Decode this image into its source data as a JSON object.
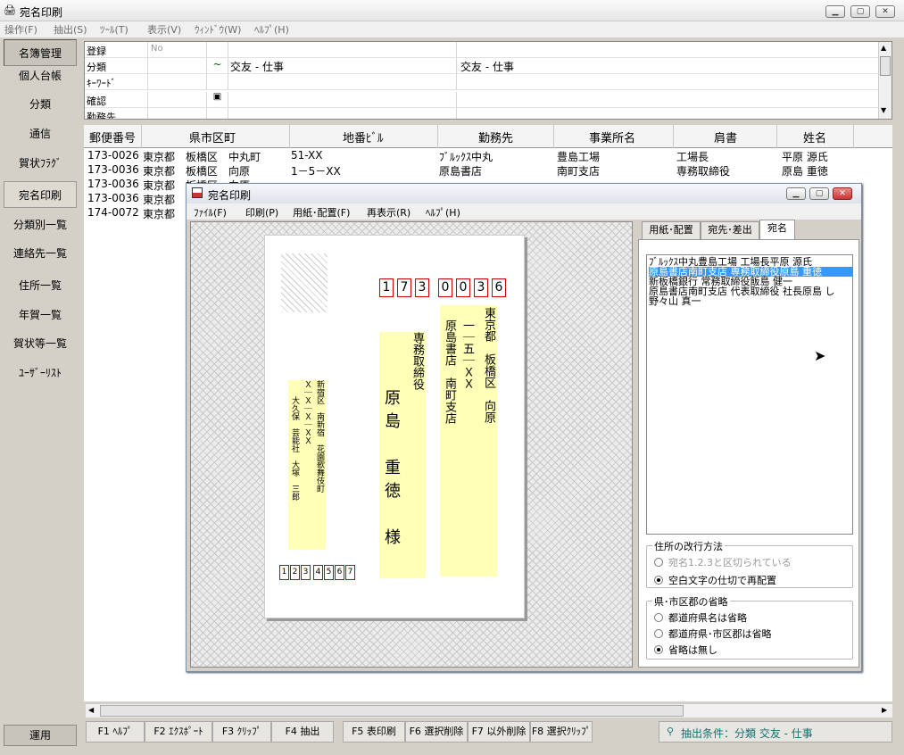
{
  "app": {
    "title": "宛名印刷",
    "menu": [
      "操作(F)",
      "抽出(S)",
      "ﾂｰﾙ(T)",
      "表示(V)",
      "ｳｨﾝﾄﾞｳ(W)",
      "ﾍﾙﾌﾟ(H)"
    ]
  },
  "sidebar": {
    "items": [
      "名簿管理",
      "個人台帳",
      "分類",
      "通信",
      "賀状ﾌﾗｸﾞ",
      "宛名印刷",
      "分類別一覧",
      "連絡先一覧",
      "住所一覧",
      "年賀一覧",
      "賀状等一覧",
      "ﾕｰｻﾞｰﾘｽﾄ"
    ],
    "bottom": "運用"
  },
  "form": {
    "rows": [
      {
        "label": "登録",
        "hint": "No",
        "mark": "",
        "value1": "",
        "value2": ""
      },
      {
        "label": "分類",
        "hint": "",
        "mark": "~",
        "value1": "交友 - 仕事",
        "value2": "交友 - 仕事"
      },
      {
        "label": "ｷｰﾜｰﾄﾞ",
        "hint": "",
        "mark": "",
        "value1": "",
        "value2": ""
      },
      {
        "label": "確認",
        "hint": "",
        "mark": "▣",
        "value1": "",
        "value2": ""
      },
      {
        "label": "勤務先",
        "hint": "",
        "mark": "",
        "value1": "",
        "value2": ""
      }
    ]
  },
  "grid": {
    "headers": [
      "郵便番号",
      "県市区町",
      "地番ﾋﾞﾙ",
      "勤務先",
      "事業所名",
      "肩書",
      "姓名"
    ],
    "rows": [
      [
        "173-0026",
        "東京都",
        "板橋区　中丸町",
        "51-XX",
        "ﾌﾞﾙｯｸｽ中丸",
        "豊島工場",
        "工場長",
        "平原 源氏"
      ],
      [
        "173-0036",
        "東京都",
        "板橋区　向原",
        "1－5－XX",
        "原島書店",
        "南町支店",
        "専務取締役",
        "原島 重徳"
      ],
      [
        "173-0036",
        "東京都",
        "板橋区　向原",
        "",
        "",
        "",
        "",
        ""
      ],
      [
        "173-0036",
        "東京都",
        "",
        "",
        "",
        "",
        "",
        ""
      ],
      [
        "174-0072",
        "東京都",
        "",
        "",
        "",
        "",
        "",
        ""
      ]
    ]
  },
  "fkeys": [
    "F1 ﾍﾙﾌﾟ",
    "F2 ｴｸｽﾎﾟｰﾄ",
    "F3 ｸﾘｯﾌﾟ",
    "F4 抽出",
    "F5 表印刷",
    "F6 選択削除",
    "F7 以外削除",
    "F8 選択ｸﾘｯﾌﾟ"
  ],
  "status": "抽出条件：分類 交友 - 仕事",
  "dialog": {
    "title": "宛名印刷",
    "menu": [
      "ﾌｧｲﾙ(F)",
      "印刷(P)",
      "用紙･配置(F)",
      "再表示(R)",
      "ﾍﾙﾌﾟ(H)"
    ],
    "card": {
      "zip": [
        "1",
        "7",
        "3",
        "0",
        "0",
        "3",
        "6"
      ],
      "address1": "東京都　板橋区　向原",
      "address2": "一｜五｜ＸＸ",
      "company": "原島書店　南町支店",
      "title": "専務取締役",
      "name": "原島　重徳　様",
      "sender_address1": "新宿区　南新宿　花園歌舞伎町",
      "sender_address2": "Ｘ｜Ｘ｜Ｘ｜ＸＸ",
      "sender_name": "大久保　芸能社　大塚　三郎",
      "sender_zip": [
        "1",
        "2",
        "3",
        "4",
        "5",
        "6",
        "7"
      ]
    },
    "tabs": [
      "用紙･配置",
      "宛先･差出",
      "宛名"
    ],
    "list": [
      "ﾌﾞﾙｯｸｽ中丸豊島工場 工場長平原 源氏",
      "原島書店南町支店 専務取締役原島 重徳",
      "新板橋銀行 常務取締役飯島 健一",
      "原島書店南町支店 代表取締役 社長原島 し",
      "野々山 真一"
    ],
    "group1": {
      "title": "住所の改行方法",
      "options": [
        "宛名1.2.3と区切られている",
        "空白文字の仕切で再配置"
      ]
    },
    "group2": {
      "title": "県･市区郡の省略",
      "options": [
        "都道府県名は省略",
        "都道府県･市区郡は省略",
        "省略は無し"
      ]
    }
  }
}
